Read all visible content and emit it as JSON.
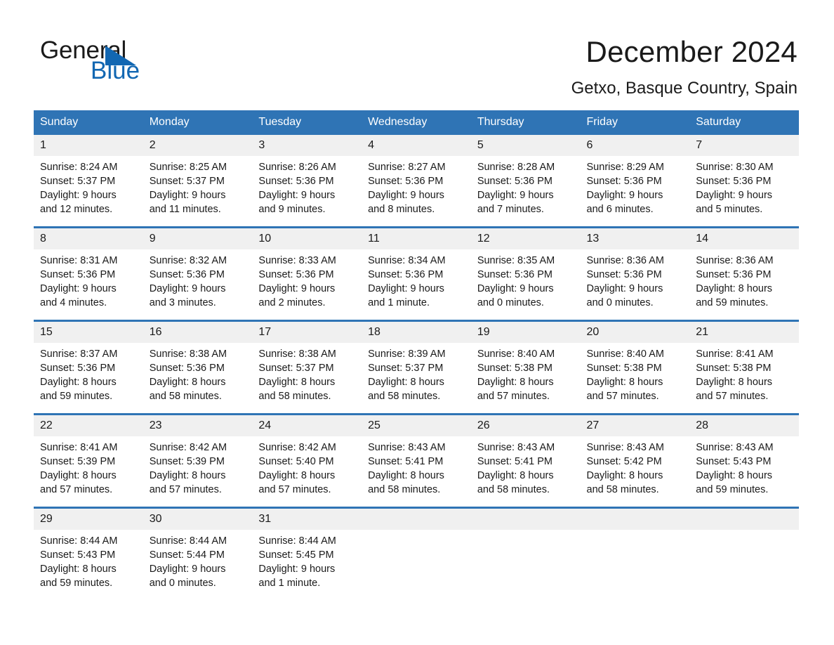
{
  "brand": {
    "name_part1": "General",
    "name_part2": "Blue",
    "accent_color": "#1267b2",
    "triangle_icon": "triangle-icon"
  },
  "header": {
    "month_title": "December 2024",
    "location": "Getxo, Basque Country, Spain"
  },
  "theme": {
    "header_blue": "#2f74b5",
    "daynum_gray": "#f0f0f0",
    "separator_blue": "#2f74b5"
  },
  "weekday_headers": [
    "Sunday",
    "Monday",
    "Tuesday",
    "Wednesday",
    "Thursday",
    "Friday",
    "Saturday"
  ],
  "weeks": [
    [
      {
        "day": "1",
        "sunrise": "Sunrise: 8:24 AM",
        "sunset": "Sunset: 5:37 PM",
        "daylight1": "Daylight: 9 hours",
        "daylight2": "and 12 minutes."
      },
      {
        "day": "2",
        "sunrise": "Sunrise: 8:25 AM",
        "sunset": "Sunset: 5:37 PM",
        "daylight1": "Daylight: 9 hours",
        "daylight2": "and 11 minutes."
      },
      {
        "day": "3",
        "sunrise": "Sunrise: 8:26 AM",
        "sunset": "Sunset: 5:36 PM",
        "daylight1": "Daylight: 9 hours",
        "daylight2": "and 9 minutes."
      },
      {
        "day": "4",
        "sunrise": "Sunrise: 8:27 AM",
        "sunset": "Sunset: 5:36 PM",
        "daylight1": "Daylight: 9 hours",
        "daylight2": "and 8 minutes."
      },
      {
        "day": "5",
        "sunrise": "Sunrise: 8:28 AM",
        "sunset": "Sunset: 5:36 PM",
        "daylight1": "Daylight: 9 hours",
        "daylight2": "and 7 minutes."
      },
      {
        "day": "6",
        "sunrise": "Sunrise: 8:29 AM",
        "sunset": "Sunset: 5:36 PM",
        "daylight1": "Daylight: 9 hours",
        "daylight2": "and 6 minutes."
      },
      {
        "day": "7",
        "sunrise": "Sunrise: 8:30 AM",
        "sunset": "Sunset: 5:36 PM",
        "daylight1": "Daylight: 9 hours",
        "daylight2": "and 5 minutes."
      }
    ],
    [
      {
        "day": "8",
        "sunrise": "Sunrise: 8:31 AM",
        "sunset": "Sunset: 5:36 PM",
        "daylight1": "Daylight: 9 hours",
        "daylight2": "and 4 minutes."
      },
      {
        "day": "9",
        "sunrise": "Sunrise: 8:32 AM",
        "sunset": "Sunset: 5:36 PM",
        "daylight1": "Daylight: 9 hours",
        "daylight2": "and 3 minutes."
      },
      {
        "day": "10",
        "sunrise": "Sunrise: 8:33 AM",
        "sunset": "Sunset: 5:36 PM",
        "daylight1": "Daylight: 9 hours",
        "daylight2": "and 2 minutes."
      },
      {
        "day": "11",
        "sunrise": "Sunrise: 8:34 AM",
        "sunset": "Sunset: 5:36 PM",
        "daylight1": "Daylight: 9 hours",
        "daylight2": "and 1 minute."
      },
      {
        "day": "12",
        "sunrise": "Sunrise: 8:35 AM",
        "sunset": "Sunset: 5:36 PM",
        "daylight1": "Daylight: 9 hours",
        "daylight2": "and 0 minutes."
      },
      {
        "day": "13",
        "sunrise": "Sunrise: 8:36 AM",
        "sunset": "Sunset: 5:36 PM",
        "daylight1": "Daylight: 9 hours",
        "daylight2": "and 0 minutes."
      },
      {
        "day": "14",
        "sunrise": "Sunrise: 8:36 AM",
        "sunset": "Sunset: 5:36 PM",
        "daylight1": "Daylight: 8 hours",
        "daylight2": "and 59 minutes."
      }
    ],
    [
      {
        "day": "15",
        "sunrise": "Sunrise: 8:37 AM",
        "sunset": "Sunset: 5:36 PM",
        "daylight1": "Daylight: 8 hours",
        "daylight2": "and 59 minutes."
      },
      {
        "day": "16",
        "sunrise": "Sunrise: 8:38 AM",
        "sunset": "Sunset: 5:36 PM",
        "daylight1": "Daylight: 8 hours",
        "daylight2": "and 58 minutes."
      },
      {
        "day": "17",
        "sunrise": "Sunrise: 8:38 AM",
        "sunset": "Sunset: 5:37 PM",
        "daylight1": "Daylight: 8 hours",
        "daylight2": "and 58 minutes."
      },
      {
        "day": "18",
        "sunrise": "Sunrise: 8:39 AM",
        "sunset": "Sunset: 5:37 PM",
        "daylight1": "Daylight: 8 hours",
        "daylight2": "and 58 minutes."
      },
      {
        "day": "19",
        "sunrise": "Sunrise: 8:40 AM",
        "sunset": "Sunset: 5:38 PM",
        "daylight1": "Daylight: 8 hours",
        "daylight2": "and 57 minutes."
      },
      {
        "day": "20",
        "sunrise": "Sunrise: 8:40 AM",
        "sunset": "Sunset: 5:38 PM",
        "daylight1": "Daylight: 8 hours",
        "daylight2": "and 57 minutes."
      },
      {
        "day": "21",
        "sunrise": "Sunrise: 8:41 AM",
        "sunset": "Sunset: 5:38 PM",
        "daylight1": "Daylight: 8 hours",
        "daylight2": "and 57 minutes."
      }
    ],
    [
      {
        "day": "22",
        "sunrise": "Sunrise: 8:41 AM",
        "sunset": "Sunset: 5:39 PM",
        "daylight1": "Daylight: 8 hours",
        "daylight2": "and 57 minutes."
      },
      {
        "day": "23",
        "sunrise": "Sunrise: 8:42 AM",
        "sunset": "Sunset: 5:39 PM",
        "daylight1": "Daylight: 8 hours",
        "daylight2": "and 57 minutes."
      },
      {
        "day": "24",
        "sunrise": "Sunrise: 8:42 AM",
        "sunset": "Sunset: 5:40 PM",
        "daylight1": "Daylight: 8 hours",
        "daylight2": "and 57 minutes."
      },
      {
        "day": "25",
        "sunrise": "Sunrise: 8:43 AM",
        "sunset": "Sunset: 5:41 PM",
        "daylight1": "Daylight: 8 hours",
        "daylight2": "and 58 minutes."
      },
      {
        "day": "26",
        "sunrise": "Sunrise: 8:43 AM",
        "sunset": "Sunset: 5:41 PM",
        "daylight1": "Daylight: 8 hours",
        "daylight2": "and 58 minutes."
      },
      {
        "day": "27",
        "sunrise": "Sunrise: 8:43 AM",
        "sunset": "Sunset: 5:42 PM",
        "daylight1": "Daylight: 8 hours",
        "daylight2": "and 58 minutes."
      },
      {
        "day": "28",
        "sunrise": "Sunrise: 8:43 AM",
        "sunset": "Sunset: 5:43 PM",
        "daylight1": "Daylight: 8 hours",
        "daylight2": "and 59 minutes."
      }
    ],
    [
      {
        "day": "29",
        "sunrise": "Sunrise: 8:44 AM",
        "sunset": "Sunset: 5:43 PM",
        "daylight1": "Daylight: 8 hours",
        "daylight2": "and 59 minutes."
      },
      {
        "day": "30",
        "sunrise": "Sunrise: 8:44 AM",
        "sunset": "Sunset: 5:44 PM",
        "daylight1": "Daylight: 9 hours",
        "daylight2": "and 0 minutes."
      },
      {
        "day": "31",
        "sunrise": "Sunrise: 8:44 AM",
        "sunset": "Sunset: 5:45 PM",
        "daylight1": "Daylight: 9 hours",
        "daylight2": "and 1 minute."
      },
      {
        "day": "",
        "sunrise": "",
        "sunset": "",
        "daylight1": "",
        "daylight2": ""
      },
      {
        "day": "",
        "sunrise": "",
        "sunset": "",
        "daylight1": "",
        "daylight2": ""
      },
      {
        "day": "",
        "sunrise": "",
        "sunset": "",
        "daylight1": "",
        "daylight2": ""
      },
      {
        "day": "",
        "sunrise": "",
        "sunset": "",
        "daylight1": "",
        "daylight2": ""
      }
    ]
  ]
}
